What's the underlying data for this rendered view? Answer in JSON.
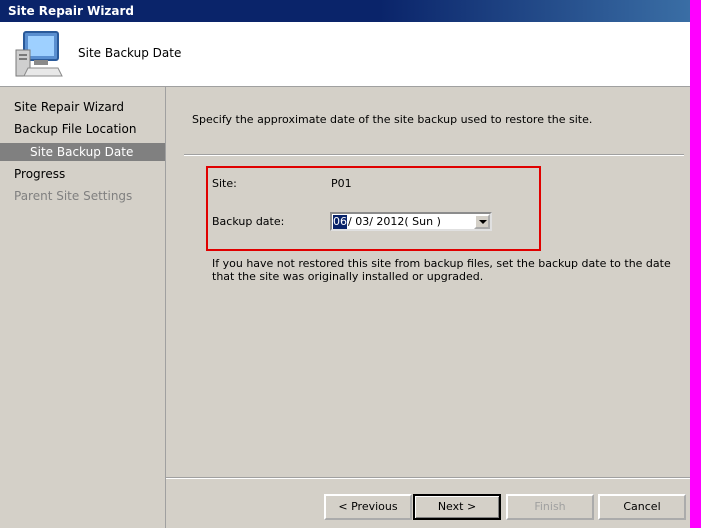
{
  "window": {
    "title": "Site Repair Wizard"
  },
  "header": {
    "title": "Site Backup Date",
    "icon": "computer-icon"
  },
  "nav": {
    "items": [
      {
        "label": "Site Repair Wizard",
        "state": "normal"
      },
      {
        "label": "Backup File Location",
        "state": "normal"
      },
      {
        "label": "Site Backup Date",
        "state": "selected"
      },
      {
        "label": "Progress",
        "state": "normal"
      },
      {
        "label": "Parent Site Settings",
        "state": "disabled"
      }
    ]
  },
  "main": {
    "instruction": "Specify the approximate date of the site backup used to restore the site.",
    "site_label": "Site:",
    "site_value": "P01",
    "backup_label": "Backup date:",
    "backup_date": {
      "month": "06",
      "rest": "/ 03/ 2012( Sun )"
    },
    "note": "If you have not restored this site from backup files, set the backup date to the date that the site was originally installed or upgraded."
  },
  "buttons": {
    "previous": "< Previous",
    "next": "Next >",
    "finish": "Finish",
    "cancel": "Cancel"
  },
  "colors": {
    "highlight_box": "#e00000",
    "selection": "#0a246a"
  }
}
